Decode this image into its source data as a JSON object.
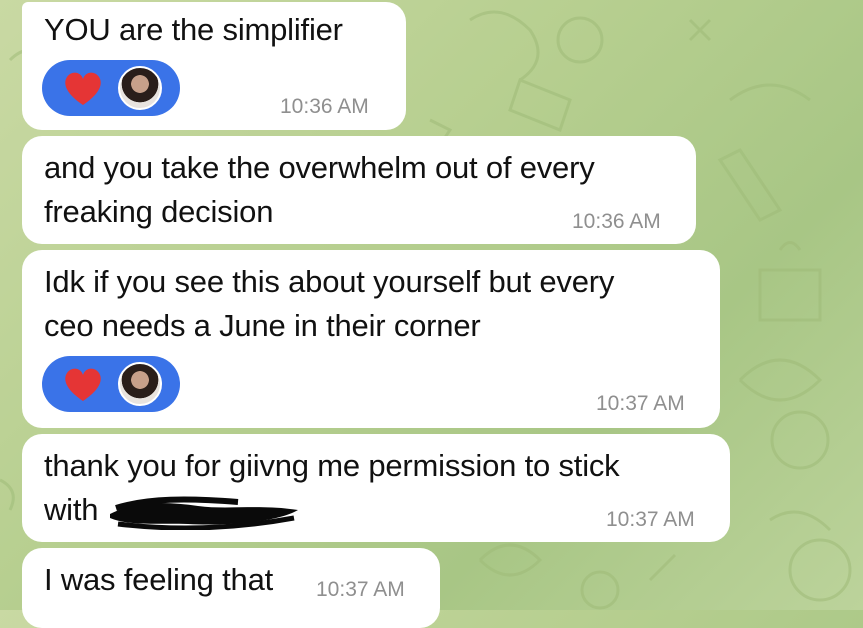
{
  "colors": {
    "bubble": "#ffffff",
    "reaction_bg": "#3a73e8",
    "heart": "#e53535",
    "timestamp": "#8f8f8f",
    "wallpaper": "#b7cf90"
  },
  "messages": [
    {
      "text": [
        "YOU are the simplifier"
      ],
      "time": "10:36 AM",
      "reaction": {
        "emoji": "heart-icon",
        "avatar": "user-avatar"
      }
    },
    {
      "text": [
        "and you take the overwhelm out of every",
        "freaking decision"
      ],
      "time": "10:36 AM"
    },
    {
      "text": [
        "Idk if you see this about yourself but every",
        "ceo needs a June in their corner"
      ],
      "time": "10:37 AM",
      "reaction": {
        "emoji": "heart-icon",
        "avatar": "user-avatar"
      }
    },
    {
      "text": [
        "thank you for giivng me permission to stick",
        "with"
      ],
      "time": "10:37 AM",
      "redacted": true
    },
    {
      "text": [
        "I was feeling that"
      ],
      "time": "10:37 AM"
    }
  ]
}
